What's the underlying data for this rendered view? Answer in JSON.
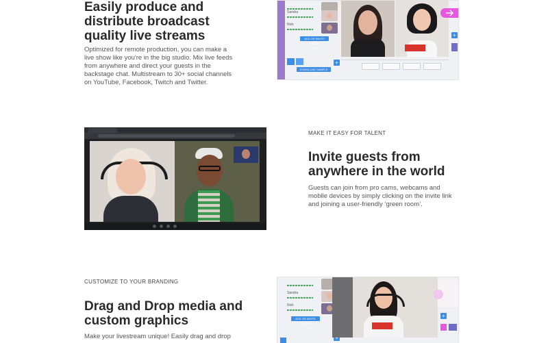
{
  "section1": {
    "title_lines": [
      "Easily produce and",
      "distribute broadcast",
      "quality live streams"
    ],
    "body_lines": [
      "Optimized for remote production, you can make a",
      "live show like you're in the big studio. Mix live feeds",
      "from anywhere and direct your guests in the",
      "backstage chat. Multistream to 30+ social channels",
      "on YouTube, Facebook, Twitch and Twitter."
    ],
    "studio": {
      "guests": [
        "Sandra",
        "Nick"
      ],
      "add_media_label": "ADD OR INVITE FEEDS",
      "download_label": "DOWNLOAD SAMPLE ASSETS"
    }
  },
  "section2": {
    "eyebrow": "MAKE IT EASY FOR TALENT",
    "title_lines": [
      "Invite guests from",
      "anywhere in the world"
    ],
    "body_lines": [
      "Guests can join from pro cams, webcams and",
      "mobile devices by simply clicking on the invite link",
      "and joining a user-friendly ‘green room’."
    ]
  },
  "section3": {
    "eyebrow": "CUSTOMIZE TO YOUR BRANDING",
    "title_lines": [
      "Drag and Drop media and",
      "custom graphics"
    ],
    "body_lines": [
      "Make your livestream unique! Easily drag and drop"
    ],
    "studio": {
      "guests": [
        "Sandra",
        "Nick"
      ],
      "add_media_label": "ADD OR INVITE FEEDS"
    }
  },
  "colors": {
    "accent_blue": "#3b8de6",
    "purple": "#9b7bc9",
    "pink": "#e75ae0",
    "green_meter": "#35b24a"
  }
}
